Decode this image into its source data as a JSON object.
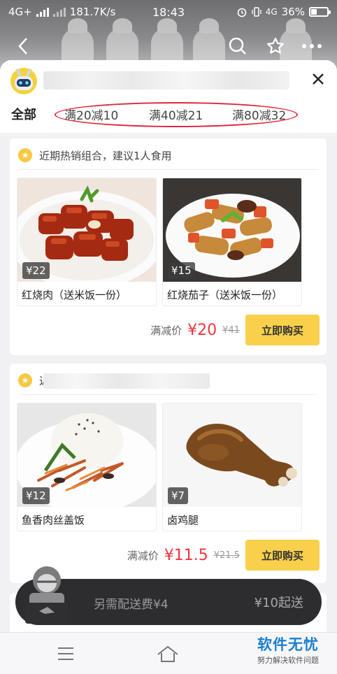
{
  "status_bar": {
    "network": "4G+",
    "speed": "181.7K/s",
    "time": "18:43",
    "network_right": "4G",
    "battery": "36%",
    "battery_level": 0.36
  },
  "header": {
    "back_icon": "chevron-left-icon",
    "search_icon": "search-icon",
    "favorite_icon": "star-outline-icon",
    "more_icon": "more-dots-icon"
  },
  "sheet": {
    "close_icon": "close-icon",
    "tabs": {
      "all": "全部",
      "promos": [
        "满20减10",
        "满40减21",
        "满80减32"
      ]
    }
  },
  "combos": [
    {
      "title": "近期热销组合，建议1人食用",
      "dishes": [
        {
          "price": "¥22",
          "name": "红烧肉（送米饭一份）"
        },
        {
          "price": "¥15",
          "name": "红烧茄子（送米饭一份）"
        }
      ],
      "discount_label": "满减价",
      "price_now": "¥20",
      "price_old": "¥41",
      "buy_label": "立即购买"
    },
    {
      "title": "近",
      "dishes": [
        {
          "price": "¥12",
          "name": "鱼香肉丝盖饭"
        },
        {
          "price": "¥7",
          "name": "卤鸡腿"
        }
      ],
      "discount_label": "满减价",
      "price_now": "¥11.5",
      "price_old": "¥21.5",
      "buy_label": "立即购买"
    }
  ],
  "cart": {
    "delivery_fee": "另需配送费¥4",
    "minimum": "¥10起送"
  },
  "bottom_nav": {
    "menu_icon": "menu-icon",
    "home_icon": "home-icon"
  },
  "watermark": {
    "title": "软件无忧",
    "subtitle": "努力解决软件问题"
  },
  "colors": {
    "accent_red": "#f0353f",
    "buy_button": "#f8d04b",
    "cart_bar": "#2d2d2f",
    "ellipse_annotation": "#e0243a",
    "watermark_blue": "#1d7fce"
  }
}
